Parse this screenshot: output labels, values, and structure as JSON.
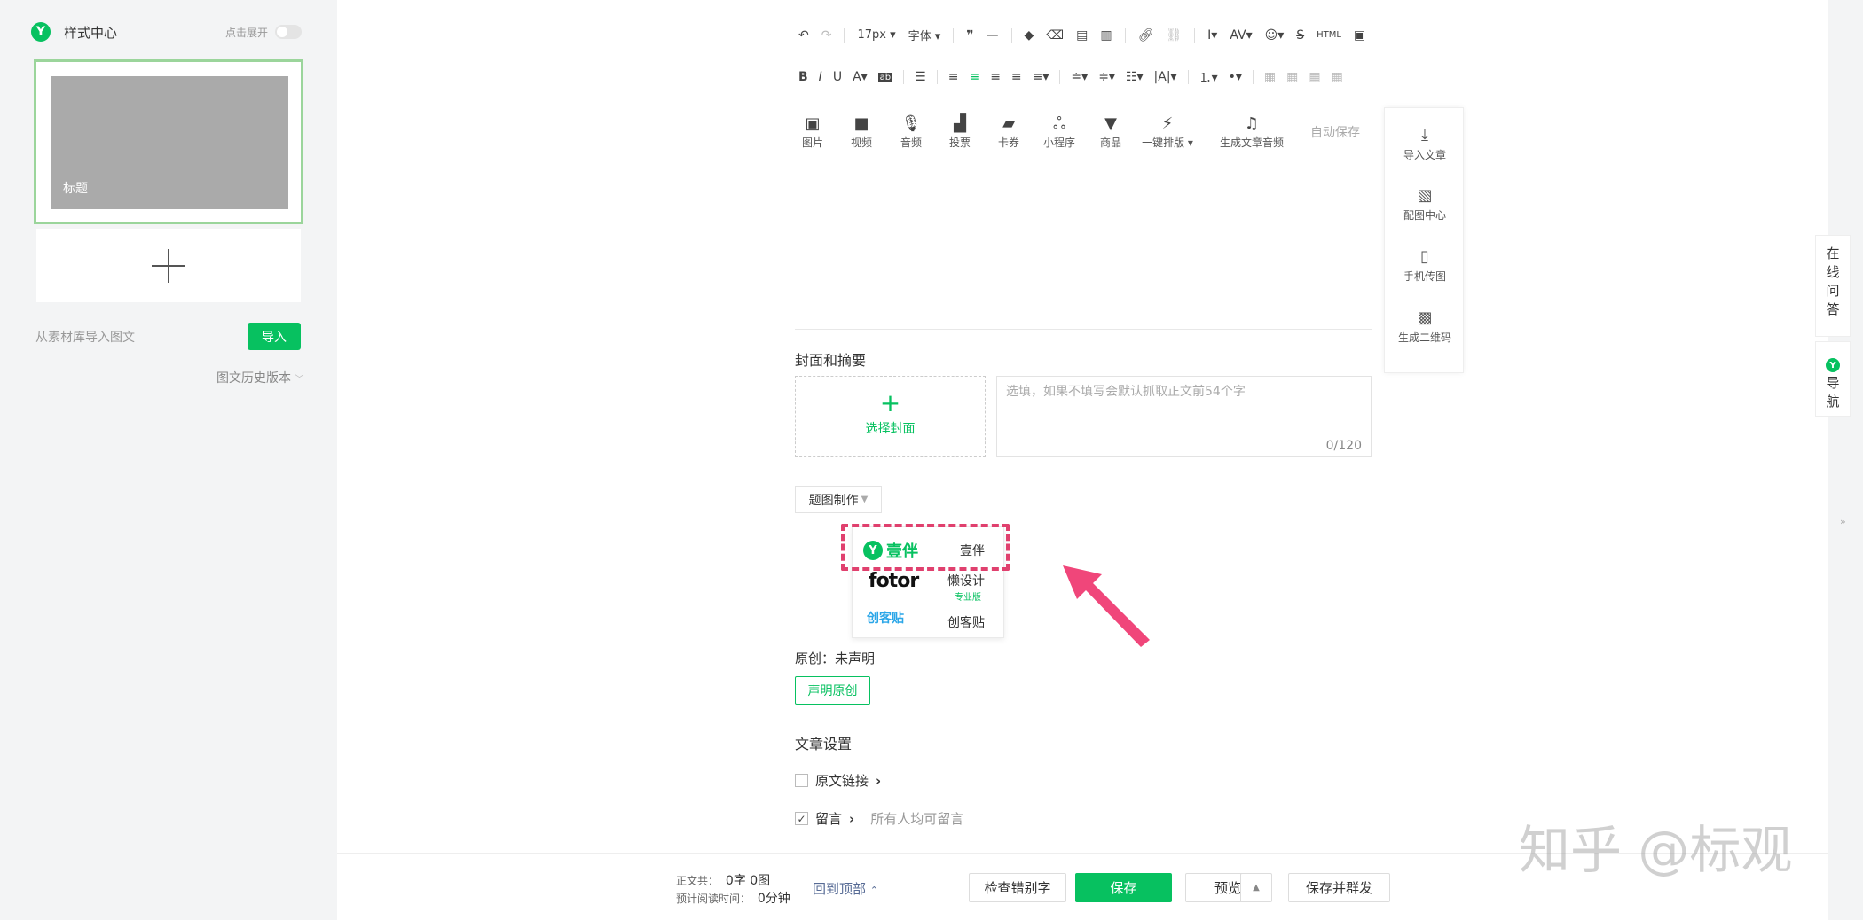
{
  "sidebar": {
    "title": "样式中心",
    "expand_label": "点击展开",
    "card_title": "标题",
    "import_hint": "从素材库导入图文",
    "import_button": "导入",
    "history_label": "图文历史版本"
  },
  "toolbar": {
    "font_size": "17px",
    "font_family": "字体",
    "media_items": [
      {
        "icon": "image-icon",
        "label": "图片"
      },
      {
        "icon": "video-icon",
        "label": "视频"
      },
      {
        "icon": "audio-icon",
        "label": "音频"
      },
      {
        "icon": "vote-icon",
        "label": "投票"
      },
      {
        "icon": "card-icon",
        "label": "卡券"
      },
      {
        "icon": "miniprogram-icon",
        "label": "小程序"
      },
      {
        "icon": "product-icon",
        "label": "商品"
      },
      {
        "icon": "one-click-layout-icon",
        "label": "一键排版"
      },
      {
        "icon": "generate-audio-icon",
        "label": "生成文章音频"
      }
    ],
    "autosave": "自动保存"
  },
  "side_panel": {
    "items": [
      {
        "icon": "import-article-icon",
        "label": "导入文章"
      },
      {
        "icon": "image-center-icon",
        "label": "配图中心"
      },
      {
        "icon": "phone-upload-icon",
        "label": "手机传图"
      },
      {
        "icon": "qrcode-icon",
        "label": "生成二维码"
      }
    ]
  },
  "cover_section": {
    "title": "封面和摘要",
    "select_cover": "选择封面",
    "summary_placeholder": "选填，如果不填写会默认抓取正文前54个字",
    "summary_count": "0/120"
  },
  "title_image": {
    "dropdown_label": "题图制作",
    "options": [
      {
        "brand": "壹伴",
        "label": "壹伴"
      },
      {
        "brand": "fotor",
        "label": "懒设计",
        "sub": "专业版"
      },
      {
        "brand": "创客贴",
        "label": "创客贴"
      }
    ]
  },
  "original": {
    "status": "原创：未声明",
    "declare_button": "声明原创"
  },
  "article_settings": {
    "title": "文章设置",
    "original_link": "原文链接",
    "comments": "留言",
    "comments_hint": "所有人均可留言"
  },
  "right_float": {
    "online_qa": "在线问答",
    "nav": "导航"
  },
  "footer": {
    "word_count_label": "正文共：",
    "word_count_value": "0字 0图",
    "read_time_label": "预计阅读时间：",
    "read_time_value": "0分钟",
    "back_to_top": "回到顶部",
    "check_typo": "检查错别字",
    "save": "保存",
    "preview": "预览",
    "save_and_send": "保存并群发"
  },
  "watermark": "知乎 @标观",
  "colors": {
    "accent": "#07c160",
    "arrow": "#f0467a",
    "highlight_border": "#e0406e"
  }
}
